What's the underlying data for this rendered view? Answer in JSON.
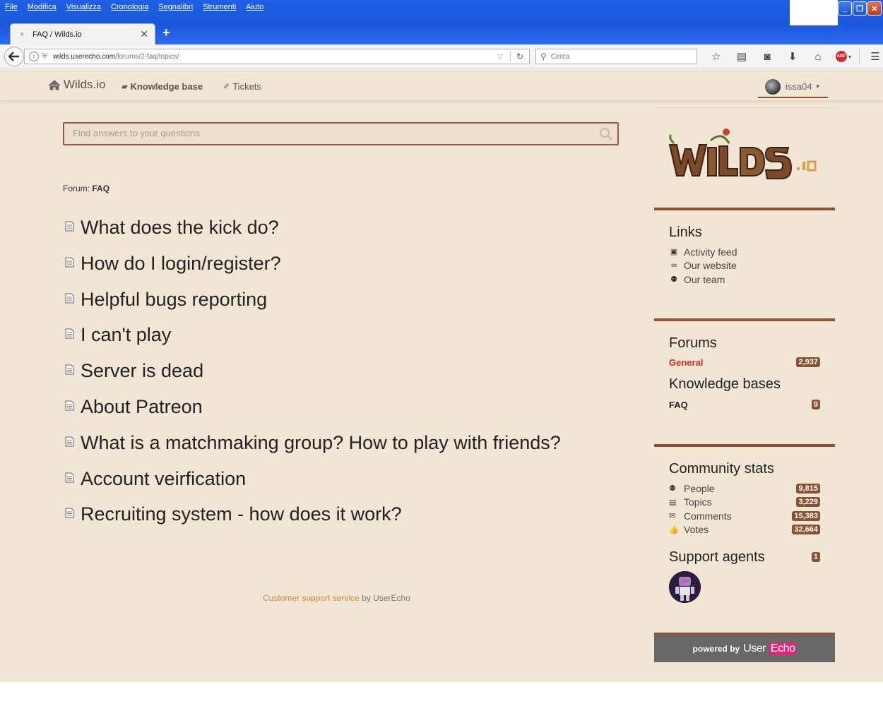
{
  "window": {
    "menu": [
      "File",
      "Modifica",
      "Visualizza",
      "Cronologia",
      "Segnalibri",
      "Strumenti",
      "Aiuto"
    ],
    "tab_title": "FAQ / Wilds.io",
    "url_host": "wilds.userecho.com",
    "url_path": "/forums/2-faq/topics/",
    "search_placeholder": "Cerca"
  },
  "nav": {
    "brand": "Wilds.io",
    "knowledge_base": "Knowledge base",
    "tickets": "Tickets",
    "user": "issa04"
  },
  "main": {
    "search_placeholder": "Find answers to your questions",
    "breadcrumb_prefix": "Forum:",
    "breadcrumb_forum": "FAQ",
    "topics": [
      "What does the kick do?",
      "How do I login/register?",
      "Helpful bugs reporting",
      "I can't play",
      "Server is dead",
      "About Patreon",
      "What is a matchmaking group? How to play with friends?",
      "Account veirfication",
      "Recruiting system - how does it work?"
    ],
    "footer_link": "Customer support service",
    "footer_by": "by UserEcho"
  },
  "sidebar": {
    "links_title": "Links",
    "links": [
      {
        "icon": "rss-icon",
        "label": "Activity feed"
      },
      {
        "icon": "link-icon",
        "label": "Our website"
      },
      {
        "icon": "team-icon",
        "label": "Our team"
      }
    ],
    "forums_title": "Forums",
    "forums": [
      {
        "label": "General",
        "count": "2,937"
      }
    ],
    "kb_title": "Knowledge bases",
    "kbs": [
      {
        "label": "FAQ",
        "count": "9"
      }
    ],
    "stats_title": "Community stats",
    "stats": [
      {
        "icon": "people-icon",
        "label": "People",
        "count": "9,815"
      },
      {
        "icon": "topics-icon",
        "label": "Topics",
        "count": "3,229"
      },
      {
        "icon": "comments-icon",
        "label": "Comments",
        "count": "15,383"
      },
      {
        "icon": "votes-icon",
        "label": "Votes",
        "count": "32,664"
      }
    ],
    "agents_title": "Support agents",
    "agents_count": "1",
    "powered_by": "powered by",
    "powered_user": "User",
    "powered_echo": "Echo"
  },
  "colors": {
    "accent": "#8a5233",
    "page_bg": "#f1e6d5",
    "forum_general": "#d22c1e",
    "footer_link": "#c9883a"
  }
}
